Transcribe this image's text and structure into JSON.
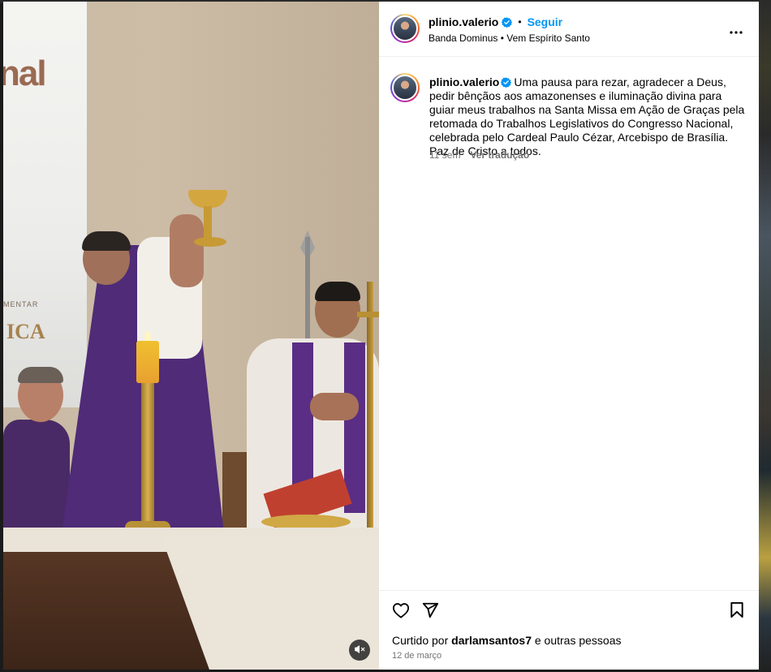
{
  "post": {
    "username": "plinio.valerio",
    "follow_label": "Seguir",
    "location": "Banda Dominus • Vem Espírito Santo",
    "caption": "Uma pausa para rezar, agradecer a Deus, pedir bênçãos aos amazonenses e iluminação divina para guiar meus trabalhos na Santa Missa em Ação de Graças pela retomada do Trabalhos Legislativos do Congresso Nacional, celebrada pelo Cardeal Paulo Cézar, Arcebispo de Brasília. Paz de Cristo a todos.",
    "caption_age": "11 sem",
    "translate_label": "Ver tradução",
    "liked_by_prefix": "Curtido por",
    "liked_by_user": "darlamsantos7",
    "liked_by_suffix": "e outras pessoas",
    "date": "12 de março"
  },
  "media": {
    "screen_text_large": "nal",
    "screen_text_small": "MENTAR",
    "screen_text_ica": "ICA"
  },
  "icons": {
    "verified": "verified-badge-icon",
    "more": "more-options-icon",
    "like": "heart-icon",
    "share": "paper-plane-icon",
    "save": "bookmark-icon",
    "mute": "muted-speaker-icon"
  },
  "colors": {
    "accent": "#0095f6",
    "secondary_text": "#737373",
    "verified": "#0095f6"
  }
}
